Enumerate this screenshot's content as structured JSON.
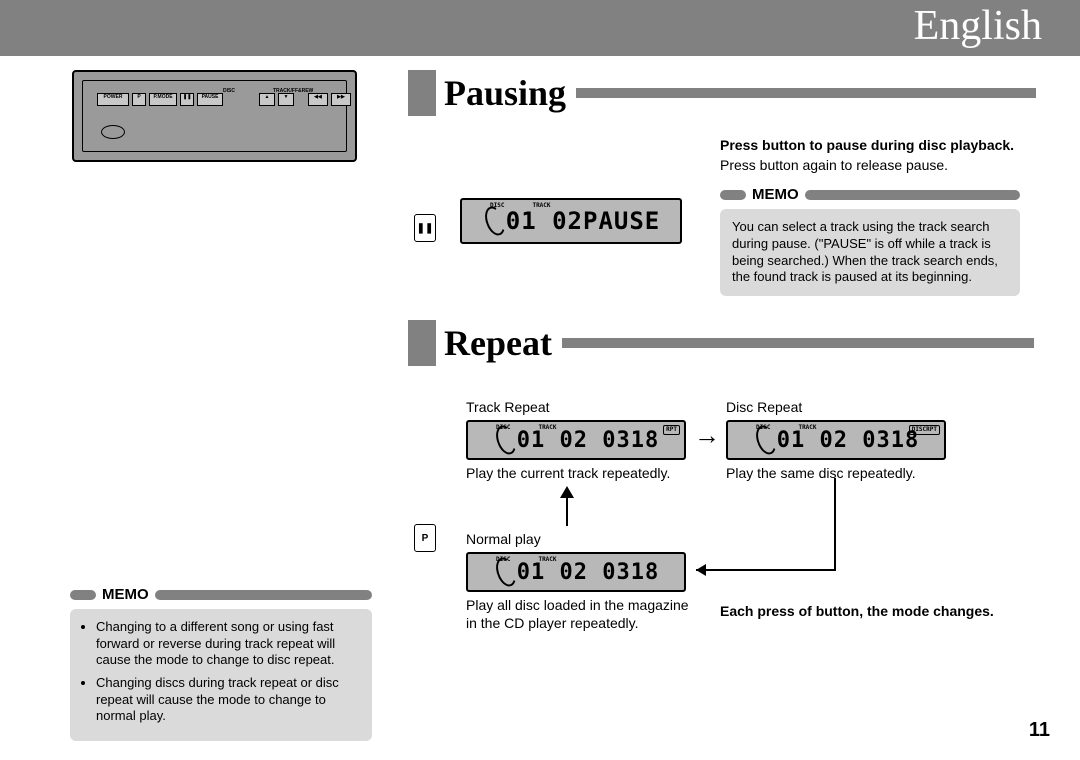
{
  "header": {
    "language": "English"
  },
  "device": {
    "buttons": [
      "POWER /ADJUST",
      "P",
      "P.MODE",
      "❚❚",
      "PAUSE",
      "DISC ▲",
      "DISC ▼",
      "TRACK/FF&REW ◀◀",
      "TRACK/FF&REW ▶▶"
    ],
    "logo": "disc"
  },
  "section_pausing": {
    "title": "Pausing",
    "lcd": {
      "disc_label": "DISC",
      "track_label": "TRACK",
      "display": "01 02PAUSE"
    },
    "icon": "❚❚",
    "instruction_bold": "Press button to pause during disc playback.",
    "instruction": "Press button again to release pause.",
    "memo": {
      "label": "MEMO",
      "text": "You can select a track using the track search during pause. (\"PAUSE\" is off while a track is being searched.) When the track search ends, the found track is paused at its beginning."
    }
  },
  "section_repeat": {
    "title": "Repeat",
    "icon": "P",
    "lcd_track": {
      "title": "Track Repeat",
      "disc_label": "DISC",
      "track_label": "TRACK",
      "badge": "RPT",
      "display": "01 02 0318",
      "caption": "Play the current track repeatedly."
    },
    "lcd_disc": {
      "title": "Disc Repeat",
      "disc_label": "DISC",
      "track_label": "TRACK",
      "badge": "DISCRPT",
      "display": "01 02 0318",
      "caption": "Play the same disc repeatedly."
    },
    "lcd_normal": {
      "title": "Normal play",
      "disc_label": "DISC",
      "track_label": "TRACK",
      "display": "01 02 0318",
      "caption": "Play all disc loaded in the magazine in the CD player repeatedly."
    },
    "mode_instruction": "Each press of button, the mode changes.",
    "memo": {
      "label": "MEMO",
      "items": [
        "Changing to a different song or using fast forward or reverse during track repeat will cause the mode to change to disc repeat.",
        "Changing discs during track repeat or disc repeat will cause the mode to change to normal play."
      ]
    }
  },
  "page_number": "11"
}
